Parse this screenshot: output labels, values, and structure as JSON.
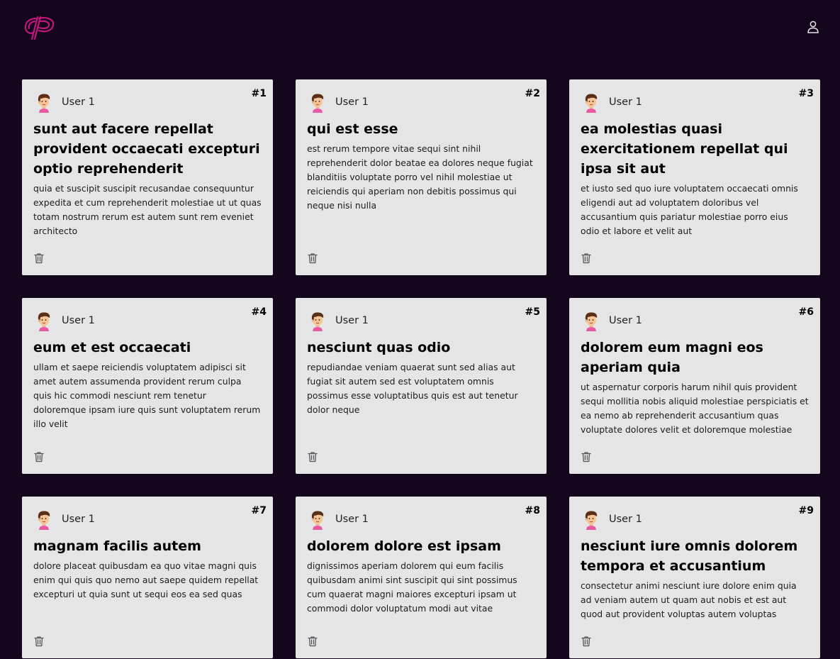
{
  "header": {
    "logo_icon": "logo-icon",
    "user_icon": "user-icon",
    "accent_color": "#c2187a"
  },
  "posts": [
    {
      "number": "#1",
      "user": "User 1",
      "title": "sunt aut facere repellat provident occaecati excepturi optio reprehenderit",
      "body": "quia et suscipit suscipit recusandae consequuntur expedita et cum reprehenderit molestiae ut ut quas totam nostrum rerum est autem sunt rem eveniet architecto"
    },
    {
      "number": "#2",
      "user": "User 1",
      "title": "qui est esse",
      "body": "est rerum tempore vitae sequi sint nihil reprehenderit dolor beatae ea dolores neque fugiat blanditiis voluptate porro vel nihil molestiae ut reiciendis qui aperiam non debitis possimus qui neque nisi nulla"
    },
    {
      "number": "#3",
      "user": "User 1",
      "title": "ea molestias quasi exercitationem repellat qui ipsa sit aut",
      "body": "et iusto sed quo iure voluptatem occaecati omnis eligendi aut ad voluptatem doloribus vel accusantium quis pariatur molestiae porro eius odio et labore et velit aut"
    },
    {
      "number": "#4",
      "user": "User 1",
      "title": "eum et est occaecati",
      "body": "ullam et saepe reiciendis voluptatem adipisci sit amet autem assumenda provident rerum culpa quis hic commodi nesciunt rem tenetur doloremque ipsam iure quis sunt voluptatem rerum illo velit"
    },
    {
      "number": "#5",
      "user": "User 1",
      "title": "nesciunt quas odio",
      "body": "repudiandae veniam quaerat sunt sed alias aut fugiat sit autem sed est voluptatem omnis possimus esse voluptatibus quis est aut tenetur dolor neque"
    },
    {
      "number": "#6",
      "user": "User 1",
      "title": "dolorem eum magni eos aperiam quia",
      "body": "ut aspernatur corporis harum nihil quis provident sequi mollitia nobis aliquid molestiae perspiciatis et ea nemo ab reprehenderit accusantium quas voluptate dolores velit et doloremque molestiae"
    },
    {
      "number": "#7",
      "user": "User 1",
      "title": "magnam facilis autem",
      "body": "dolore placeat quibusdam ea quo vitae magni quis enim qui quis quo nemo aut saepe quidem repellat excepturi ut quia sunt ut sequi eos ea sed quas"
    },
    {
      "number": "#8",
      "user": "User 1",
      "title": "dolorem dolore est ipsam",
      "body": "dignissimos aperiam dolorem qui eum facilis quibusdam animi sint suscipit qui sint possimus cum quaerat magni maiores excepturi ipsam ut commodi dolor voluptatum modi aut vitae"
    },
    {
      "number": "#9",
      "user": "User 1",
      "title": "nesciunt iure omnis dolorem tempora et accusantium",
      "body": "consectetur animi nesciunt iure dolore enim quia ad veniam autem ut quam aut nobis et est aut quod aut provident voluptas autem voluptas"
    }
  ]
}
